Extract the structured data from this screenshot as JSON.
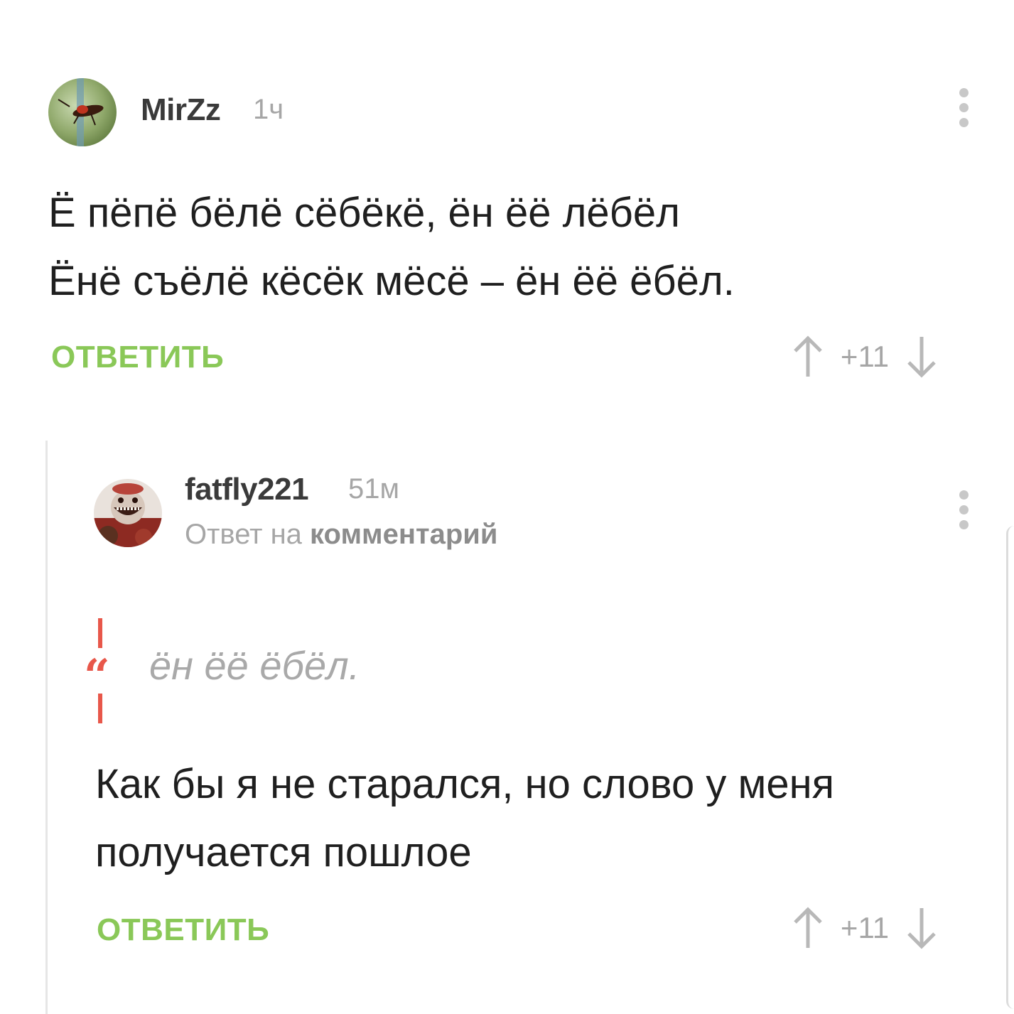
{
  "comments": [
    {
      "author": "MirZz",
      "time": "1ч",
      "lines": [
        "Ё пёпё бёлё сёбёкё, ён ёё лёбёл",
        "Ёнё съёлё кёсёк мёсё – ён ёё ёбёл."
      ],
      "reply_label": "ОТВЕТИТЬ",
      "rating": "+11"
    },
    {
      "author": "fatfly221",
      "time": "51м",
      "reply_to_prefix": "Ответ на",
      "reply_to_target": "комментарий",
      "quote_mark": "“",
      "quote": "ён ёё ёбёл.",
      "lines": [
        "Как бы я не старался, но слово у меня",
        "получается пошлое"
      ],
      "reply_label": "ОТВЕТИТЬ",
      "rating": "+11"
    }
  ],
  "colors": {
    "accent_green": "#8ac858",
    "quote_red": "#e8574a",
    "muted_gray": "#a6a6a6"
  },
  "icons": {
    "upvote": "arrow-up-icon",
    "downvote": "arrow-down-icon",
    "menu": "more-vertical-icon"
  }
}
